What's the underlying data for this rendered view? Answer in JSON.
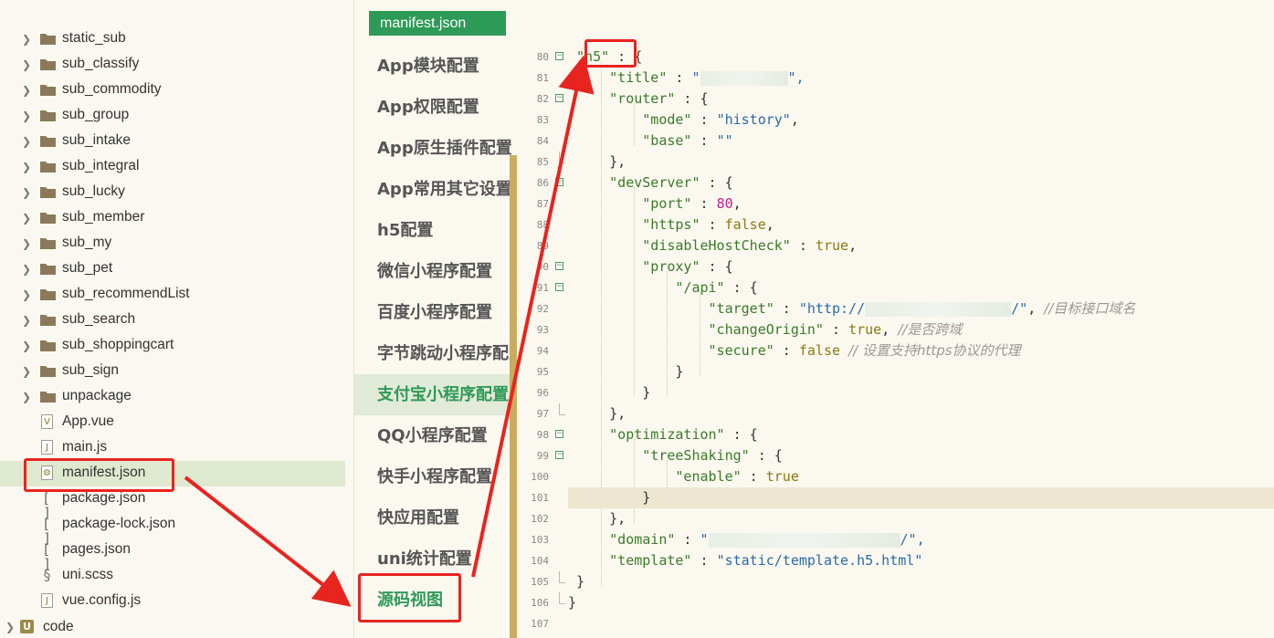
{
  "file_tree": {
    "folders": [
      "static_sub",
      "sub_classify",
      "sub_commodity",
      "sub_group",
      "sub_intake",
      "sub_integral",
      "sub_lucky",
      "sub_member",
      "sub_my",
      "sub_pet",
      "sub_recommendList",
      "sub_search",
      "sub_shoppingcart",
      "sub_sign",
      "unpackage"
    ],
    "files": [
      {
        "name": "App.vue",
        "icon": "vue-file-icon",
        "glyph": "V"
      },
      {
        "name": "main.js",
        "icon": "js-file-icon",
        "glyph": "J"
      },
      {
        "name": "manifest.json",
        "icon": "json-config-icon",
        "glyph": "⚙"
      },
      {
        "name": "package.json",
        "icon": "json-brackets-icon",
        "glyph": "[ ]"
      },
      {
        "name": "package-lock.json",
        "icon": "json-brackets-icon",
        "glyph": "[ ]"
      },
      {
        "name": "pages.json",
        "icon": "json-brackets-icon",
        "glyph": "[ ]"
      },
      {
        "name": "uni.scss",
        "icon": "scss-file-icon",
        "glyph": "§"
      },
      {
        "name": "vue.config.js",
        "icon": "js-file-icon",
        "glyph": "J"
      }
    ],
    "selected": "manifest.json",
    "project": {
      "name": "code",
      "glyph": "U"
    }
  },
  "manifest_tab": "manifest.json",
  "nav": {
    "items": [
      "App模块配置",
      "App权限配置",
      "App原生插件配置",
      "App常用其它设置",
      "h5配置",
      "微信小程序配置",
      "百度小程序配置",
      "字节跳动小程序配置",
      "支付宝小程序配置",
      "QQ小程序配置",
      "快手小程序配置",
      "快应用配置",
      "uni统计配置",
      "源码视图"
    ],
    "active": "支付宝小程序配置",
    "highlighted": "源码视图"
  },
  "editor": {
    "current_line": "101",
    "lines": [
      {
        "no": "80"
      },
      {
        "no": "81"
      },
      {
        "no": "82"
      },
      {
        "no": "83"
      },
      {
        "no": "84"
      },
      {
        "no": "85"
      },
      {
        "no": "86"
      },
      {
        "no": "87"
      },
      {
        "no": "88"
      },
      {
        "no": "89"
      },
      {
        "no": "90"
      },
      {
        "no": "91"
      },
      {
        "no": "92"
      },
      {
        "no": "93"
      },
      {
        "no": "94"
      },
      {
        "no": "95"
      },
      {
        "no": "96"
      },
      {
        "no": "97"
      },
      {
        "no": "98"
      },
      {
        "no": "99"
      },
      {
        "no": "100"
      },
      {
        "no": "101"
      },
      {
        "no": "102"
      },
      {
        "no": "103"
      },
      {
        "no": "104"
      },
      {
        "no": "105"
      },
      {
        "no": "106"
      },
      {
        "no": "107"
      }
    ],
    "tokens": {
      "h5_key": "\"h5\"",
      "title_key": "\"title\"",
      "title_val_open": "\"",
      "title_val_close": "\",",
      "router_key": "\"router\"",
      "mode_key": "\"mode\"",
      "mode_val": "\"history\"",
      "base_key": "\"base\"",
      "base_val": "\"\"",
      "devServer_key": "\"devServer\"",
      "port_key": "\"port\"",
      "port_val": "80",
      "https_key": "\"https\"",
      "https_val": "false",
      "dhc_key": "\"disableHostCheck\"",
      "dhc_val": "true",
      "proxy_key": "\"proxy\"",
      "api_key": "\"/api\"",
      "target_key": "\"target\"",
      "target_val_start": "\"http://",
      "target_val_end": "/\"",
      "target_comment": "//目标接口域名",
      "co_key": "\"changeOrigin\"",
      "co_val": "true",
      "co_comment": "//是否跨域",
      "secure_key": "\"secure\"",
      "secure_val": "false",
      "secure_comment": "// 设置支持https协议的代理",
      "opt_key": "\"optimization\"",
      "ts_key": "\"treeShaking\"",
      "enable_key": "\"enable\"",
      "enable_val": "true",
      "domain_key": "\"domain\"",
      "domain_val_start": "\"",
      "domain_val_end": "/\",",
      "template_key": "\"template\"",
      "template_val": "\"static/template.h5.html\""
    }
  },
  "colors": {
    "accent_green": "#2e9a58",
    "annotation_red": "#e8241f",
    "scroll_gold": "#c8ad60"
  }
}
